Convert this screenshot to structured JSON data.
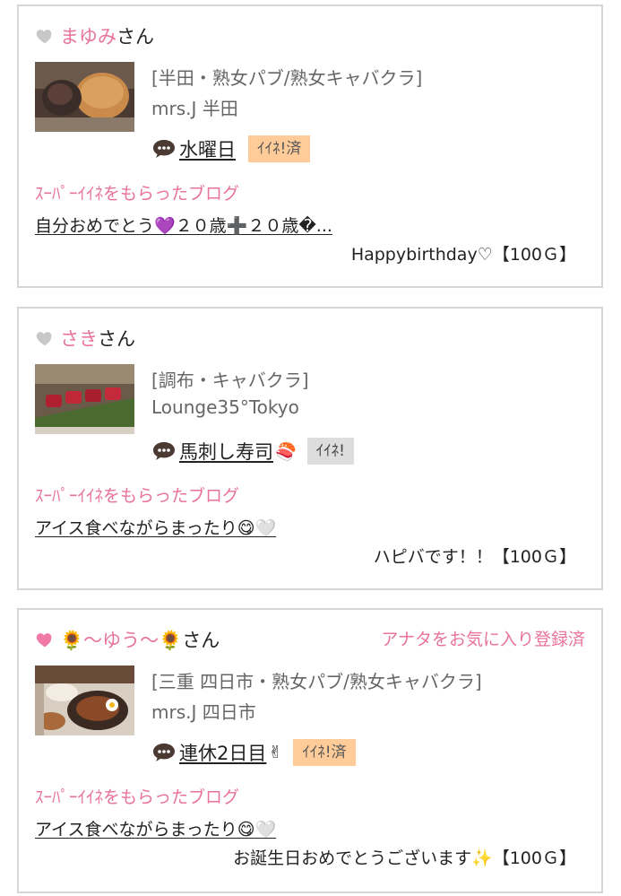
{
  "entries": [
    {
      "heart_icon": "heart-grey",
      "heart_color": "#c8c8c8",
      "user_name": "まゆみ",
      "honorific": "さん",
      "fav_status": "",
      "thumbnail": "food-photo-bread",
      "shop_category": "[半田・熟女パブ/熟女キャバクラ]",
      "shop_name": "mrs.J 半田",
      "post_icon": "speech-bubble-icon",
      "post_title": "水曜日",
      "post_emoji": "",
      "iine_label": "ｲｲﾈ!済",
      "iine_state": "done",
      "super_label": "ｽｰﾊﾟｰｲｲﾈをもらったブログ",
      "blog_title": "自分おめでとう💜２０歳➕２０歳�...",
      "message": "Happybirthday♡【100Ｇ】"
    },
    {
      "heart_icon": "heart-grey",
      "heart_color": "#c8c8c8",
      "user_name": "さき",
      "honorific": "さん",
      "fav_status": "",
      "thumbnail": "food-photo-sushi",
      "shop_category": "[調布・キャバクラ]",
      "shop_name": "Lounge35°Tokyo",
      "post_icon": "speech-bubble-icon",
      "post_title": "馬刺し寿司",
      "post_emoji": "🍣",
      "iine_label": "ｲｲﾈ!",
      "iine_state": "available",
      "super_label": "ｽｰﾊﾟｰｲｲﾈをもらったブログ",
      "blog_title": "アイス食べながらまったり😋🤍",
      "message": "ハピバです！！【100Ｇ】"
    },
    {
      "heart_icon": "heart-pink",
      "heart_color": "#f07aa5",
      "user_name": "🌻〜ゆう〜🌻",
      "honorific": "さん",
      "fav_status": "アナタをお気に入り登録済",
      "thumbnail": "food-photo-hamburg",
      "shop_category": "[三重 四日市・熟女パブ/熟女キャバクラ]",
      "shop_name": "mrs.J 四日市",
      "post_icon": "speech-bubble-icon",
      "post_title": "連休2日目",
      "post_emoji": "✌",
      "iine_label": "ｲｲﾈ!済",
      "iine_state": "done",
      "super_label": "ｽｰﾊﾟｰｲｲﾈをもらったブログ",
      "blog_title": "アイス食べながらまったり😋🤍",
      "message": "お誕生日おめでとうございます✨【100Ｇ】"
    }
  ],
  "colors": {
    "accent_pink": "#e8739b",
    "iine_done_bg": "#ffcc99",
    "iine_available_bg": "#dddddd",
    "card_border": "#d6d6d6"
  }
}
